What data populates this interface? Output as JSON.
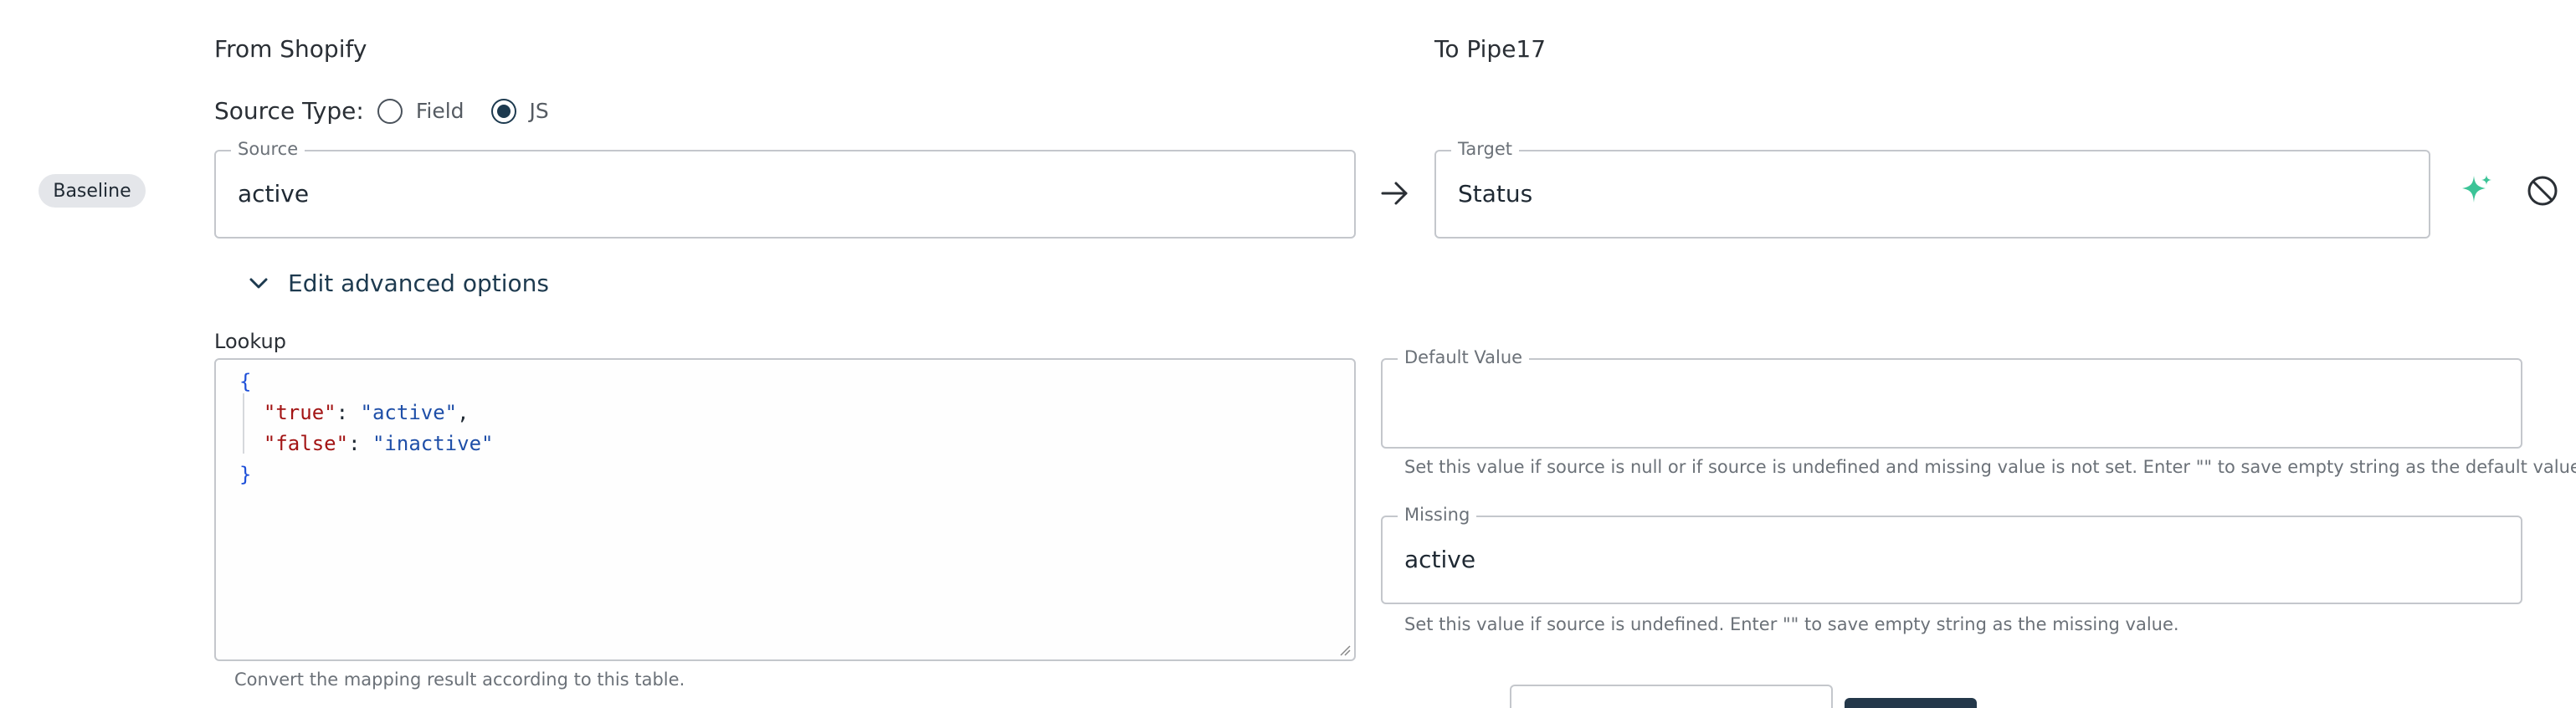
{
  "headers": {
    "from": "From Shopify",
    "to": "To Pipe17"
  },
  "source_type": {
    "label": "Source Type:",
    "options": [
      {
        "label": "Field",
        "selected": false
      },
      {
        "label": "JS",
        "selected": true
      }
    ]
  },
  "baseline_chip": "Baseline",
  "source_field": {
    "legend": "Source",
    "value": "active"
  },
  "target_field": {
    "legend": "Target",
    "value": "Status"
  },
  "icons": {
    "arrow": "arrow-right-icon",
    "sparkle": "sparkle-icon",
    "sparkle_color": "#3cc497",
    "disable": "block-icon"
  },
  "advanced_toggle": "Edit advanced options",
  "lookup": {
    "label": "Lookup",
    "lines": [
      "{",
      "\"true\": \"active\",",
      "\"false\": \"inactive\"",
      "}"
    ],
    "entries": [
      {
        "key": "\"true\"",
        "value": "\"active\""
      },
      {
        "key": "\"false\"",
        "value": "\"inactive\""
      }
    ],
    "helper": "Convert the mapping result according to this table."
  },
  "default_value": {
    "legend": "Default Value",
    "value": "",
    "helper": "Set this value if source is null or if source is undefined and missing value is not set. Enter \"\" to save empty string as the default value."
  },
  "missing": {
    "legend": "Missing",
    "value": "active",
    "helper": "Set this value if source is undefined. Enter \"\" to save empty string as the missing value."
  }
}
